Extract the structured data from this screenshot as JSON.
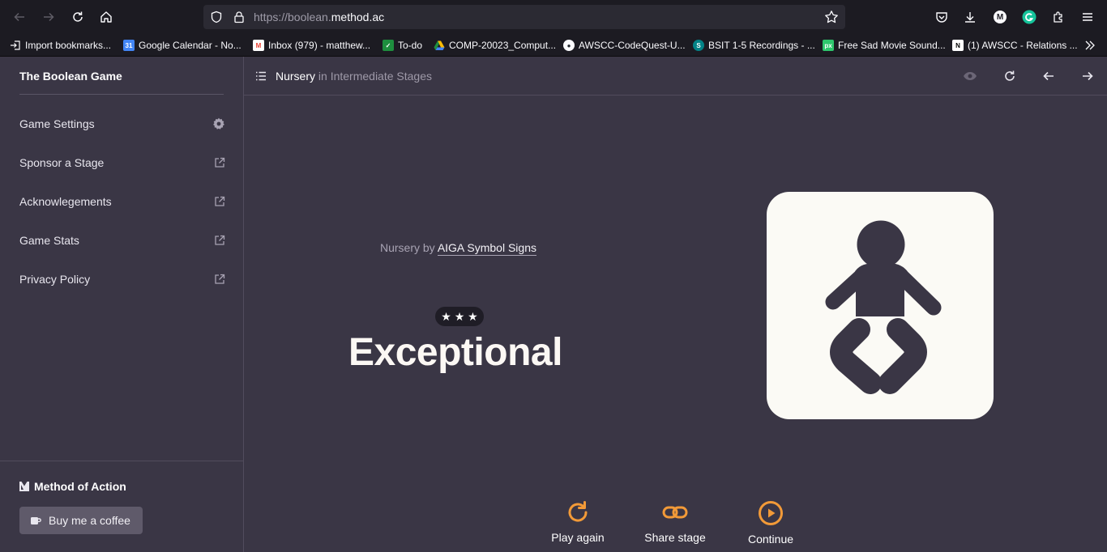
{
  "browser": {
    "url_scheme": "https://boolean.",
    "url_host": "method.ac",
    "bookmarks": [
      {
        "label": "Import bookmarks...",
        "icon": "import-icon",
        "color": "#2b2a33"
      },
      {
        "label": "Google Calendar - No...",
        "icon": "calendar-icon",
        "color": "#4285f4"
      },
      {
        "label": "Inbox (979) - matthew...",
        "icon": "gmail-icon",
        "color": "#ea4335"
      },
      {
        "label": "To-do",
        "icon": "classroom-icon",
        "color": "#1e8e3e"
      },
      {
        "label": "COMP-20023_Comput...",
        "icon": "drive-icon",
        "color": "#fbbc04"
      },
      {
        "label": "AWSCC-CodeQuest-U...",
        "icon": "github-icon",
        "color": "#24292f"
      },
      {
        "label": "BSIT 1-5 Recordings - ...",
        "icon": "sharepoint-icon",
        "color": "#038387"
      },
      {
        "label": "Free Sad Movie Sound...",
        "icon": "pixabay-icon",
        "color": "#2ec66d"
      },
      {
        "label": "(1) AWSCC - Relations ...",
        "icon": "notion-icon",
        "color": "#ffffff"
      }
    ],
    "profile_initial": "M"
  },
  "sidebar": {
    "title": "The Boolean Game",
    "items": [
      {
        "label": "Game Settings",
        "icon": "gear-icon"
      },
      {
        "label": "Sponsor a Stage",
        "icon": "external-link-icon"
      },
      {
        "label": "Acknowlegements",
        "icon": "external-link-icon"
      },
      {
        "label": "Game Stats",
        "icon": "external-link-icon"
      },
      {
        "label": "Privacy Policy",
        "icon": "external-link-icon"
      }
    ],
    "brand": "Method of Action",
    "coffee_label": "Buy me a coffee"
  },
  "header": {
    "stage": "Nursery",
    "group": " in Intermediate Stages"
  },
  "content": {
    "credit_prefix": "Nursery by ",
    "credit_link": "AIGA Symbol Signs",
    "stars": "★ ★ ★",
    "star_count": 3,
    "result": "Exceptional"
  },
  "actions": [
    {
      "label": "Play again",
      "icon": "replay-icon"
    },
    {
      "label": "Share stage",
      "icon": "link-icon"
    },
    {
      "label": "Continue",
      "icon": "play-circle-icon"
    }
  ],
  "colors": {
    "accent": "#f29a38",
    "background": "#3a3645",
    "sign_background": "#fbfaf5",
    "figure": "#3a3645"
  }
}
